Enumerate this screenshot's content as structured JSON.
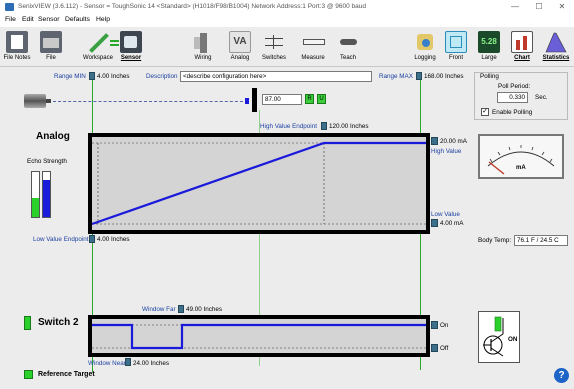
{
  "window": {
    "title": "SenixVIEW (3.6.112) - Sensor = ToughSonic 14 <Standard> (H1018/F98/B1004)  Network Address:1  Port:3 @ 9600 baud",
    "minimize": "—",
    "maximize": "☐",
    "close": "✕"
  },
  "menu": [
    "File",
    "Edit",
    "Sensor",
    "Defaults",
    "Help"
  ],
  "toolbar": {
    "file_notes": "File Notes",
    "file": "File",
    "workspace": "Workspace",
    "sensor": "Sensor",
    "wiring": "Wiring",
    "analog": "Analog",
    "switches": "Switches",
    "measure": "Measure",
    "teach": "Teach",
    "logging": "Logging",
    "front": "Front",
    "large": "Large",
    "large_value": "5.28",
    "chart": "Chart",
    "statistics": "Statistics",
    "analog_icon": "VA"
  },
  "config": {
    "range_min_label": "Range MIN",
    "range_min_value": "4.00 Inches",
    "description_label": "Description",
    "description_value": "<describe configuration here>",
    "range_max_label": "Range MAX",
    "range_max_value": "168.00 Inches",
    "distance_value": "87.00",
    "btn_r": "R",
    "btn_u": "U"
  },
  "polling": {
    "group_label": "Polling",
    "period_label": "Poll Period:",
    "period_value": "0.330",
    "period_unit": "Sec.",
    "enable_label": "Enable Polling",
    "enabled": true
  },
  "analog": {
    "title": "Analog",
    "echo_label": "Echo Strength",
    "high_endpoint_label": "High Value Endpoint",
    "high_endpoint_value": "120.00 Inches",
    "high_ma": "20.00 mA",
    "high_value_label": "High Value",
    "low_value_label": "Low Value",
    "low_ma": "4.00 mA",
    "low_endpoint_label": "Low Value Endpoint",
    "low_endpoint_value": "4.00 Inches",
    "meter_unit": "mA",
    "body_temp_label": "Body Temp:",
    "body_temp_value": "76.1 F / 24.5 C"
  },
  "switch": {
    "title": "Switch 2",
    "window_far_label": "Window Far",
    "window_far_value": "49.00 Inches",
    "window_near_label": "Window Near",
    "window_near_value": "24.00 Inches",
    "on_label": "On",
    "off_label": "Off",
    "output_state": "ON",
    "reference_label": "Reference Target",
    "help": "?"
  },
  "colors": {
    "signal": "#1a1adb",
    "panel_bg": "#d4d4d4",
    "green_line": "#2aa82a",
    "led_green": "#2bd12b"
  }
}
